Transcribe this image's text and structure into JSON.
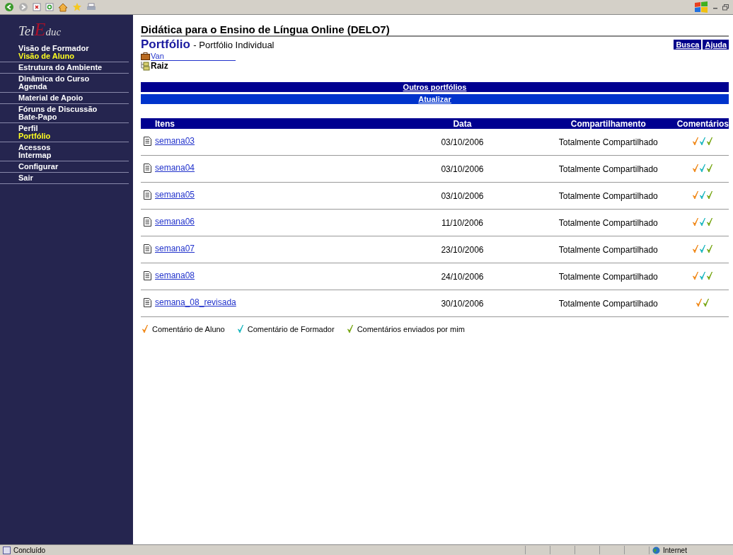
{
  "sidebar": {
    "logo": {
      "part_1": "Tel",
      "part_2": "E",
      "part_3": "duc"
    },
    "groups": [
      [
        {
          "label": "Visão de Formador",
          "selected": false
        },
        {
          "label": "Visão de Aluno",
          "selected": true
        }
      ],
      [
        {
          "label": "Estrutura do Ambiente",
          "selected": false
        }
      ],
      [
        {
          "label": "Dinâmica do Curso",
          "selected": false
        },
        {
          "label": "Agenda",
          "selected": false
        }
      ],
      [
        {
          "label": "Material de Apoio",
          "selected": false
        }
      ],
      [
        {
          "label": "Fóruns de Discussão",
          "selected": false
        },
        {
          "label": "Bate-Papo",
          "selected": false
        }
      ],
      [
        {
          "label": "Perfil",
          "selected": false
        },
        {
          "label": "Portfólio",
          "selected": true
        }
      ],
      [
        {
          "label": "Acessos",
          "selected": false
        },
        {
          "label": "Intermap",
          "selected": false
        }
      ],
      [
        {
          "label": "Configurar",
          "selected": false
        }
      ],
      [
        {
          "label": "Sair",
          "selected": false
        }
      ]
    ]
  },
  "course_title": "Didática para o Ensino de Língua Online (DELO7)",
  "page_title": "Portfólio",
  "page_subtitle": "- Portfólio Individual",
  "header_links": [
    "Busca",
    "Ajuda"
  ],
  "owner_link": "Van",
  "folder": "Raiz",
  "bars": [
    {
      "label": "Outros portfólios",
      "kind": "dark"
    },
    {
      "label": "Atualizar",
      "kind": "bright"
    }
  ],
  "table": {
    "columns": [
      "Itens",
      "Data",
      "Compartilhamento",
      "Comentários"
    ],
    "rows": [
      {
        "item": "semana03",
        "date": "03/10/2006",
        "sharing": "Totalmente Compartilhado",
        "comments": [
          {
            "color": "#f08a1c"
          },
          {
            "color": "#20b8c0"
          },
          {
            "color": "#7aa818"
          }
        ]
      },
      {
        "item": "semana04",
        "date": "03/10/2006",
        "sharing": "Totalmente Compartilhado",
        "comments": [
          {
            "color": "#f08a1c"
          },
          {
            "color": "#20b8c0"
          },
          {
            "color": "#7aa818"
          }
        ]
      },
      {
        "item": "semana05",
        "date": "03/10/2006",
        "sharing": "Totalmente Compartilhado",
        "comments": [
          {
            "color": "#f08a1c"
          },
          {
            "color": "#20b8c0"
          },
          {
            "color": "#7aa818"
          }
        ]
      },
      {
        "item": "semana06",
        "date": "11/10/2006",
        "sharing": "Totalmente Compartilhado",
        "comments": [
          {
            "color": "#f08a1c"
          },
          {
            "color": "#20b8c0"
          },
          {
            "color": "#7aa818"
          }
        ]
      },
      {
        "item": "semana07",
        "date": "23/10/2006",
        "sharing": "Totalmente Compartilhado",
        "comments": [
          {
            "color": "#f08a1c"
          },
          {
            "color": "#20b8c0"
          },
          {
            "color": "#7aa818"
          }
        ]
      },
      {
        "item": "semana08",
        "date": "24/10/2006",
        "sharing": "Totalmente Compartilhado",
        "comments": [
          {
            "color": "#f08a1c"
          },
          {
            "color": "#20b8c0"
          },
          {
            "color": "#7aa818"
          }
        ]
      },
      {
        "item": "semana_08_revisada",
        "date": "30/10/2006",
        "sharing": "Totalmente Compartilhado",
        "comments": [
          {
            "color": "#f08a1c"
          },
          {
            "color": "#7aa818"
          }
        ]
      }
    ]
  },
  "legend": [
    {
      "label": "Comentário de Aluno",
      "color": "#f08a1c"
    },
    {
      "label": "Comentário de Formador",
      "color": "#20b8c0"
    },
    {
      "label": "Comentários enviados por mim",
      "color": "#7aa818"
    }
  ],
  "status_bar": {
    "status": "Concluído",
    "zone": "Internet"
  }
}
